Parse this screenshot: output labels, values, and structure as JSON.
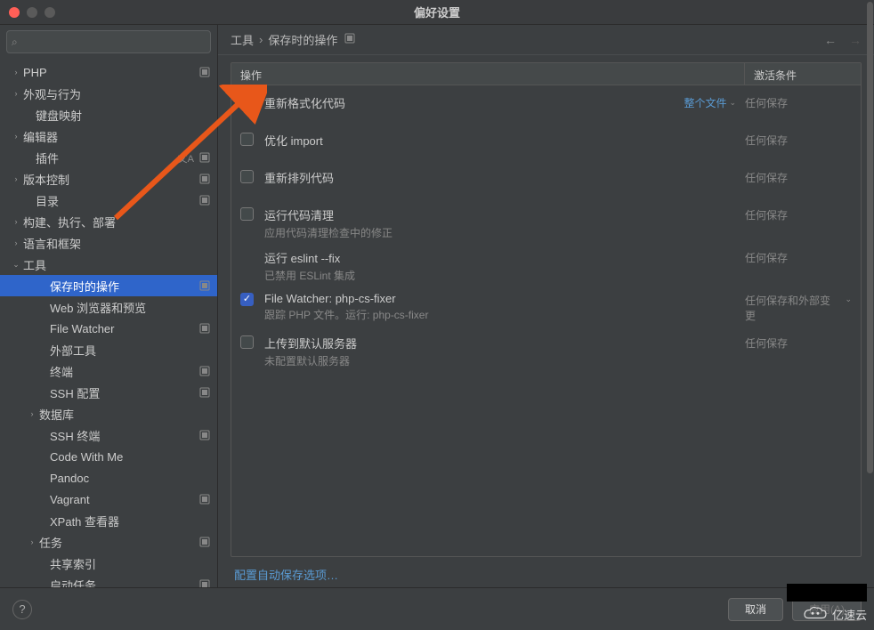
{
  "window": {
    "title": "偏好设置"
  },
  "search": {
    "placeholder": ""
  },
  "sidebar": {
    "items": [
      {
        "label": "PHP",
        "chev": "›",
        "lvl": 1,
        "badge": true
      },
      {
        "label": "外观与行为",
        "chev": "›",
        "lvl": 1
      },
      {
        "label": "键盘映射",
        "chev": "",
        "lvl": 1
      },
      {
        "label": "编辑器",
        "chev": "›",
        "lvl": 1
      },
      {
        "label": "插件",
        "chev": "",
        "lvl": 1,
        "badge": true,
        "lang": true
      },
      {
        "label": "版本控制",
        "chev": "›",
        "lvl": 1,
        "badge": true
      },
      {
        "label": "目录",
        "chev": "",
        "lvl": 1,
        "badge": true
      },
      {
        "label": "构建、执行、部署",
        "chev": "›",
        "lvl": 1
      },
      {
        "label": "语言和框架",
        "chev": "›",
        "lvl": 1
      },
      {
        "label": "工具",
        "chev": "⌄",
        "lvl": 1
      },
      {
        "label": "保存时的操作",
        "chev": "",
        "lvl": 2,
        "selected": true,
        "badge": true
      },
      {
        "label": "Web 浏览器和预览",
        "chev": "",
        "lvl": 2
      },
      {
        "label": "File Watcher",
        "chev": "",
        "lvl": 2,
        "badge": true
      },
      {
        "label": "外部工具",
        "chev": "",
        "lvl": 2
      },
      {
        "label": "终端",
        "chev": "",
        "lvl": 2,
        "badge": true
      },
      {
        "label": "SSH 配置",
        "chev": "",
        "lvl": 2,
        "badge": true
      },
      {
        "label": "数据库",
        "chev": "›",
        "lvl": 3
      },
      {
        "label": "SSH 终端",
        "chev": "",
        "lvl": 2,
        "badge": true
      },
      {
        "label": "Code With Me",
        "chev": "",
        "lvl": 2
      },
      {
        "label": "Pandoc",
        "chev": "",
        "lvl": 2
      },
      {
        "label": "Vagrant",
        "chev": "",
        "lvl": 2,
        "badge": true
      },
      {
        "label": "XPath 查看器",
        "chev": "",
        "lvl": 2
      },
      {
        "label": "任务",
        "chev": "›",
        "lvl": 3,
        "badge": true
      },
      {
        "label": "共享索引",
        "chev": "",
        "lvl": 2
      },
      {
        "label": "启动任务",
        "chev": "",
        "lvl": 2,
        "badge": true
      }
    ]
  },
  "breadcrumb": {
    "root": "工具",
    "current": "保存时的操作"
  },
  "table": {
    "headers": {
      "action": "操作",
      "condition": "激活条件"
    },
    "rows": [
      {
        "checked": false,
        "label": "重新格式化代码",
        "sub": "",
        "scope": "整个文件",
        "cond": "任何保存"
      },
      {
        "checked": false,
        "label": "优化 import",
        "sub": "",
        "cond": "任何保存"
      },
      {
        "checked": false,
        "label": "重新排列代码",
        "sub": "",
        "cond": "任何保存"
      },
      {
        "checked": false,
        "label": "运行代码清理",
        "sub": "应用代码清理检查中的修正",
        "cond": "任何保存"
      },
      {
        "checked": false,
        "label": "运行 eslint --fix",
        "sub": "已禁用 ESLint 集成",
        "cond": "任何保存",
        "nocheck": true
      },
      {
        "checked": true,
        "label": "File Watcher: php-cs-fixer",
        "sub": "跟踪 PHP 文件。运行: php-cs-fixer",
        "cond": "任何保存和外部变更",
        "condchev": true
      },
      {
        "checked": false,
        "label": "上传到默认服务器",
        "sub": "未配置默认服务器",
        "cond": "任何保存"
      }
    ]
  },
  "link": "配置自动保存选项…",
  "buttons": {
    "cancel": "取消",
    "apply": "应用(A)"
  },
  "watermark": "亿速云"
}
